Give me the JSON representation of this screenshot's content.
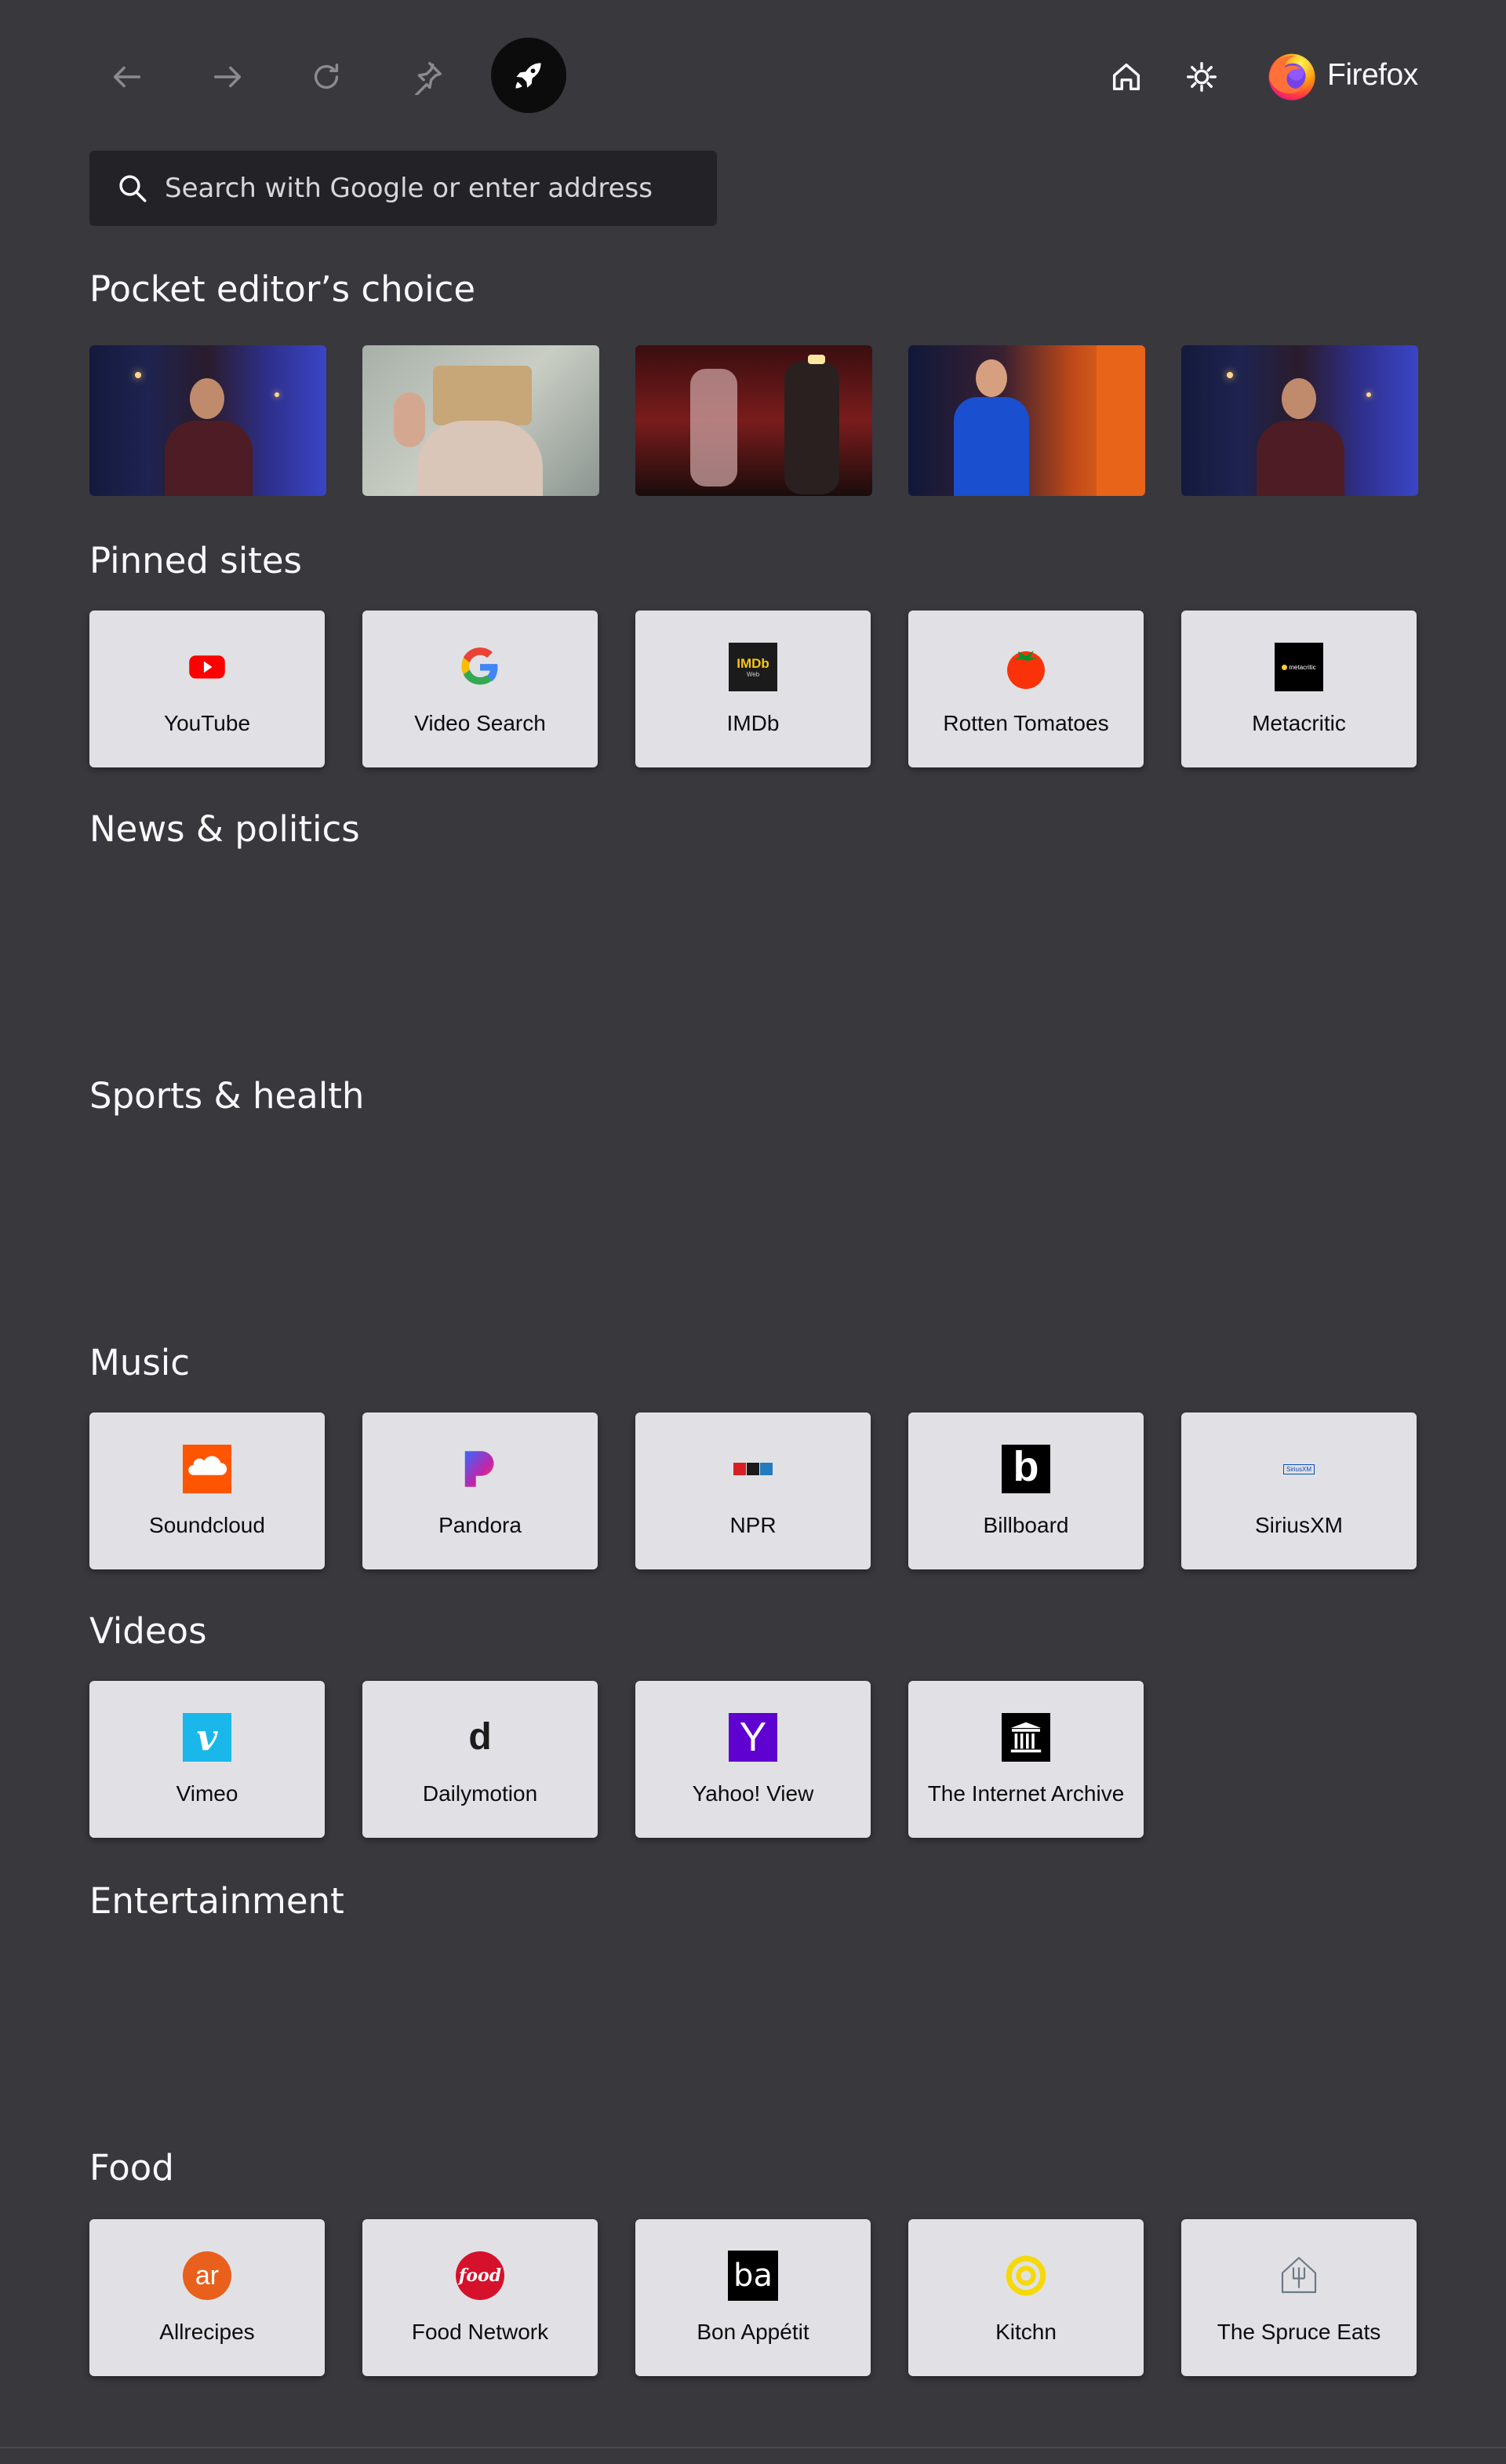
{
  "search": {
    "placeholder": "Search with Google or enter address"
  },
  "brand": {
    "name": "Firefox"
  },
  "toolbar": {
    "icons": [
      "back-arrow-icon",
      "forward-arrow-icon",
      "reload-icon",
      "pin-icon",
      "rocket-icon",
      "home-icon",
      "settings-icon",
      "firefox-logo"
    ]
  },
  "sections": {
    "pocket": "Pocket editor’s choice",
    "pinned": "Pinned sites",
    "news": "News & politics",
    "sports": "Sports & health",
    "music": "Music",
    "videos": "Videos",
    "entertainment": "Entertainment",
    "food": "Food"
  },
  "pinned": [
    "YouTube",
    "Video Search",
    "IMDb",
    "Rotten Tomatoes",
    "Metacritic"
  ],
  "music": [
    "Soundcloud",
    "Pandora",
    "NPR",
    "Billboard",
    "SiriusXM"
  ],
  "videos": [
    "Vimeo",
    "Dailymotion",
    "Yahoo! View",
    "The Internet Archive"
  ],
  "food": [
    "Allrecipes",
    "Food Network",
    "Bon Appétit",
    "Kitchn",
    "The Spruce Eats"
  ],
  "logos": {
    "imdb": "IMDb",
    "imdb_sub": "Web",
    "npr": "npr",
    "billboard": "b",
    "siriusxm": "SiriusXM",
    "vimeo": "v",
    "dailymotion": "d",
    "yahoo": "Y",
    "allrecipes": "ar",
    "foodnetwork": "food",
    "bonappetit": "ba",
    "metacritic": "metacritic"
  },
  "colors": {
    "background": "#38383d",
    "tile": "#e1e1e5",
    "youtube": "#ff0000",
    "soundcloud": "#ff5500",
    "vimeo": "#1ab7ea",
    "yahoo": "#5f01d1"
  }
}
